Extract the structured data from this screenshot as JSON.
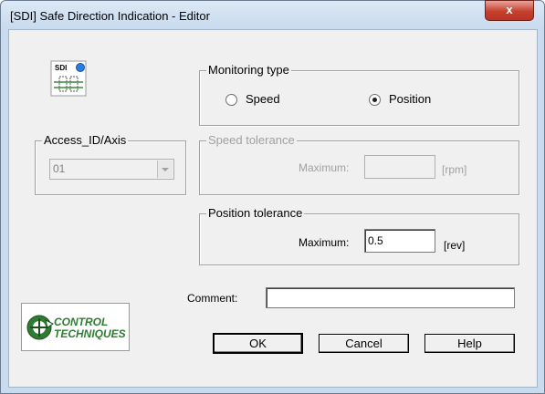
{
  "window": {
    "title": "[SDI] Safe Direction Indication - Editor",
    "close_label": "x"
  },
  "icon": {
    "label": "SDI"
  },
  "monitoring": {
    "legend": "Monitoring type",
    "speed_label": "Speed",
    "position_label": "Position",
    "selected": "Position"
  },
  "access": {
    "legend": "Access_ID/Axis",
    "value": "01"
  },
  "speed_tolerance": {
    "legend": "Speed tolerance",
    "max_label": "Maximum:",
    "value": "",
    "unit": "[rpm]"
  },
  "position_tolerance": {
    "legend": "Position tolerance",
    "max_label": "Maximum:",
    "value": "0.5",
    "unit": "[rev]"
  },
  "comment": {
    "label": "Comment:",
    "value": ""
  },
  "buttons": {
    "ok": "OK",
    "cancel": "Cancel",
    "help": "Help"
  },
  "logo": {
    "line1": "CONTROL",
    "line2": "TECHNIQUES"
  },
  "colors": {
    "accent_close": "#c7402e",
    "logo_green": "#2e7d32"
  }
}
